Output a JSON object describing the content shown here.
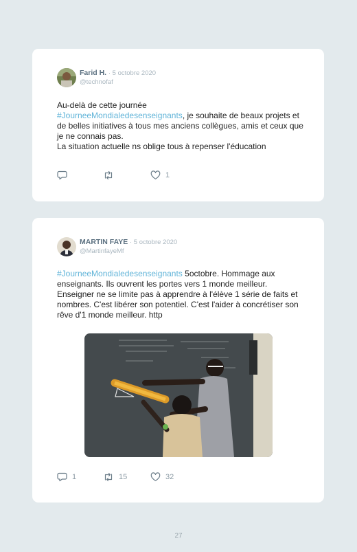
{
  "tweets": [
    {
      "author": "Farid H.",
      "date": "· 5 octobre 2020",
      "handle": "@technofaf",
      "text_before": "Au-delà de cette journée",
      "hashtag": "#JourneeMondialedesenseignants",
      "text_after": ", je souhaite de beaux projets et de belles initiatives à tous mes anciens collègues, amis et ceux que je ne connais pas.",
      "text_line2": "La situation actuelle ns oblige tous à repenser l'éducation",
      "reply_count": "",
      "retweet_count": "",
      "like_count": "1"
    },
    {
      "author": "MARTIN FAYE",
      "date": "· 5 octobre 2020",
      "handle": "@MartinfayeMf",
      "hashtag": "#JourneeMondialedesenseignants",
      "text_after": " 5octobre. Hommage aux enseignants. Ils ouvrent les portes vers 1 monde meilleur. Enseigner ne se limite pas à apprendre à l'élève 1 série de faits et nombres. C'est libérer son potentiel. C'est l'aider à concrétiser son rêve d'1 monde meilleur. http",
      "reply_count": "1",
      "retweet_count": "15",
      "like_count": "32"
    }
  ],
  "icons": {
    "reply": "reply-icon",
    "retweet": "retweet-icon",
    "like": "heart-icon"
  },
  "colors": {
    "background": "#e3eaed",
    "card": "#ffffff",
    "hashtag": "#5fb3d8",
    "name": "#5b7080",
    "meta": "#a9b6bf"
  },
  "page_number": "27"
}
